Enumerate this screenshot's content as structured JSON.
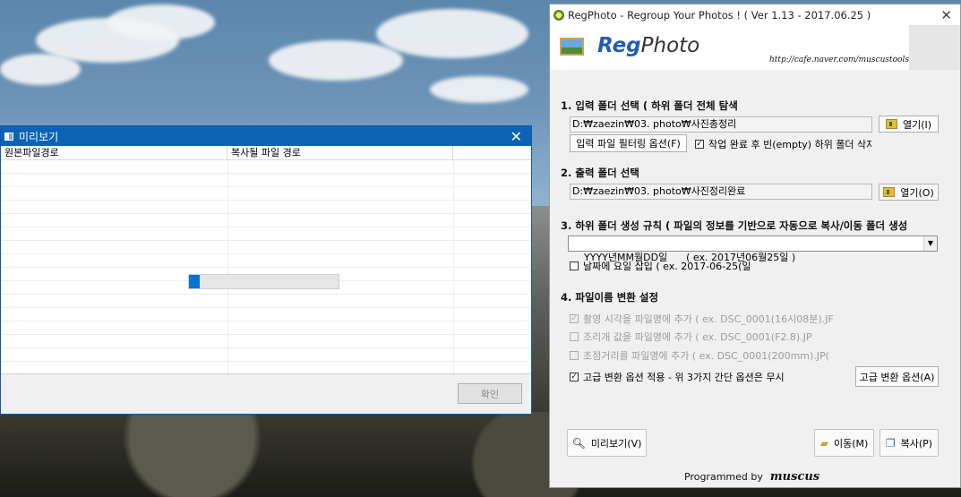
{
  "preview_window": {
    "title": "미리보기",
    "columns": [
      "원본파일경로",
      "복사될 파일 경로",
      ""
    ],
    "progress_fraction": 0.07,
    "ok_label": "확인"
  },
  "regphoto": {
    "title": "RegPhoto - Regroup Your Photos ! ( Ver 1.13 - 2017.06.25 )",
    "logo_reg": "Reg",
    "logo_photo": "Photo",
    "url": "http://cafe.naver.com/muscustools",
    "section1": {
      "label": "1. 입력 폴더 선택 ( 하위 폴더 전체 탐색",
      "path": "D:₩zaezin₩03. photo₩사진총정리",
      "open_label": "열기(I)",
      "filter_label": "입력 파일 필터링 옵션(F)",
      "delete_empty_label": "작업 완료 후 빈(empty) 하위 폴더 삭자",
      "delete_empty_checked": true
    },
    "section2": {
      "label": "2. 출력 폴더 선택",
      "path": "D:₩zaezin₩03. photo₩사진정리완료",
      "open_label": "열기(O)"
    },
    "section3": {
      "label": "3. 하위 폴더 생성 규칙 ( 파일의 정보를 기반으로 자동으로 복사/이동 폴더 생성",
      "rule_value": "YYYY년MM월DD일      ( ex. 2017년06월25일 )",
      "weekday_label": "날짜에 요일 삽입 ( ex. 2017-06-25(일",
      "weekday_checked": false
    },
    "section4": {
      "label": "4. 파일이름 변환 설정",
      "option1_label": "촬영 시각을 파일명에 추가 ( ex. DSC_0001(16시08분).JF",
      "option2_label": "조리개 값을 파일명에 추가 ( ex. DSC_0001(F2.8).JP",
      "option3_label": "초점거리를 파일명에 추가 ( ex. DSC_0001(200mm).JP(",
      "advanced_label": "고급 변환 옵션 적용 - 위 3가지 간단 옵션은 무시",
      "advanced_checked": true,
      "advanced_button": "고급 변환 옵션(A)"
    },
    "buttons": {
      "preview": "미리보기(V)",
      "move": "이동(M)",
      "copy": "복사(P)"
    },
    "footer": {
      "programmed_by": "Programmed by",
      "signature": "muscus"
    }
  },
  "colors": {
    "accent": "#0c63b5",
    "progress": "#0a72d1",
    "logo_reg": "#1f5fb0"
  },
  "icons": [
    "checkbox-icon",
    "close-icon",
    "folder-icon",
    "magnifier-icon",
    "copy-icon",
    "dropdown-arrow-icon"
  ]
}
